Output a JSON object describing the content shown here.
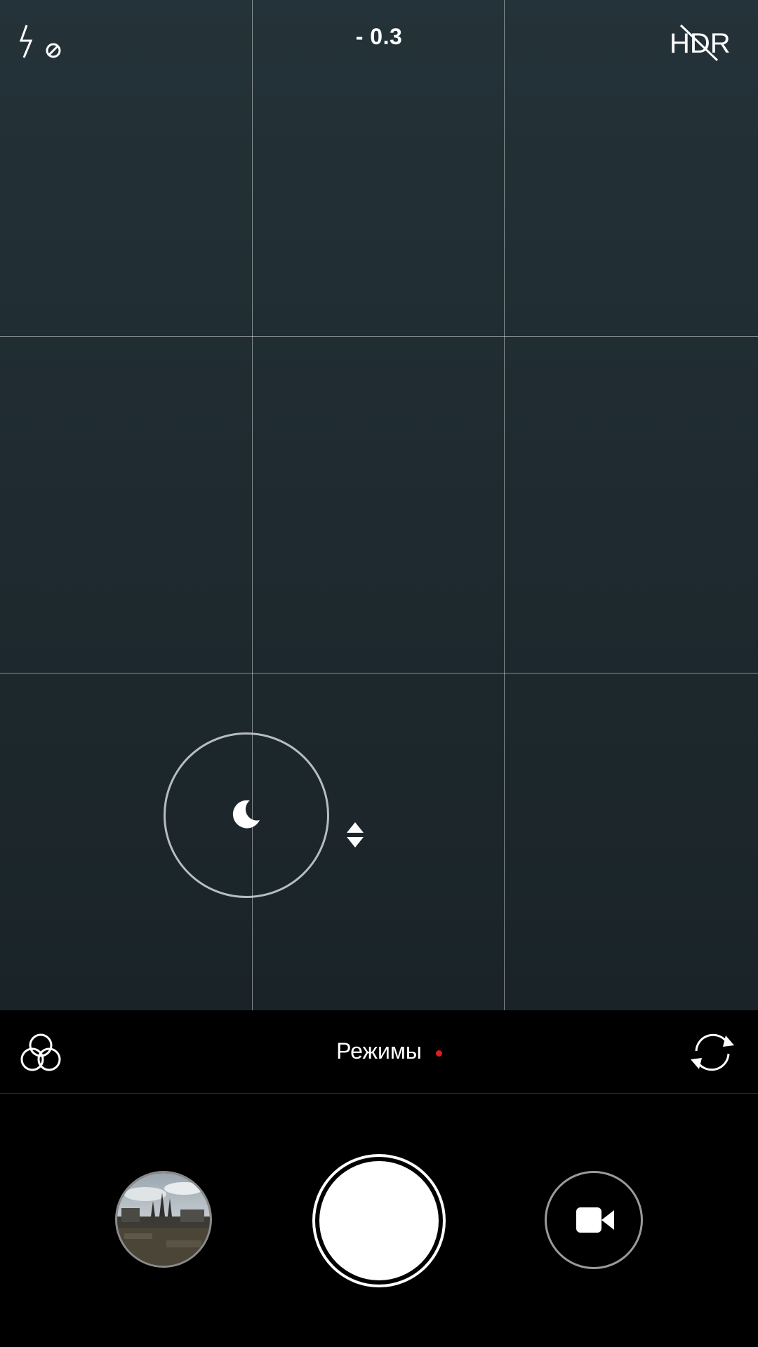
{
  "viewfinder": {
    "exposure_value": "- 0.3",
    "grid_enabled": true,
    "focus_indicator_icon": "moon-icon",
    "exposure_adjust_icon": "up-down-arrows-icon"
  },
  "top_controls": {
    "flash_icon": "flash-off-icon",
    "hdr_icon": "hdr-off-icon",
    "hdr_text": "HDR"
  },
  "mode_bar": {
    "filters_icon": "filters-icon",
    "modes_label": "Режимы",
    "new_indicator_color": "#e21b1b",
    "switch_camera_icon": "switch-camera-icon"
  },
  "bottom_controls": {
    "gallery_thumbnail": "last-photo-thumbnail",
    "shutter": "shutter-button",
    "video_icon": "video-camera-icon"
  },
  "colors": {
    "viewfinder_bg": "#1f2b31",
    "accent_dot": "#e21b1b",
    "icon": "#ffffff"
  }
}
